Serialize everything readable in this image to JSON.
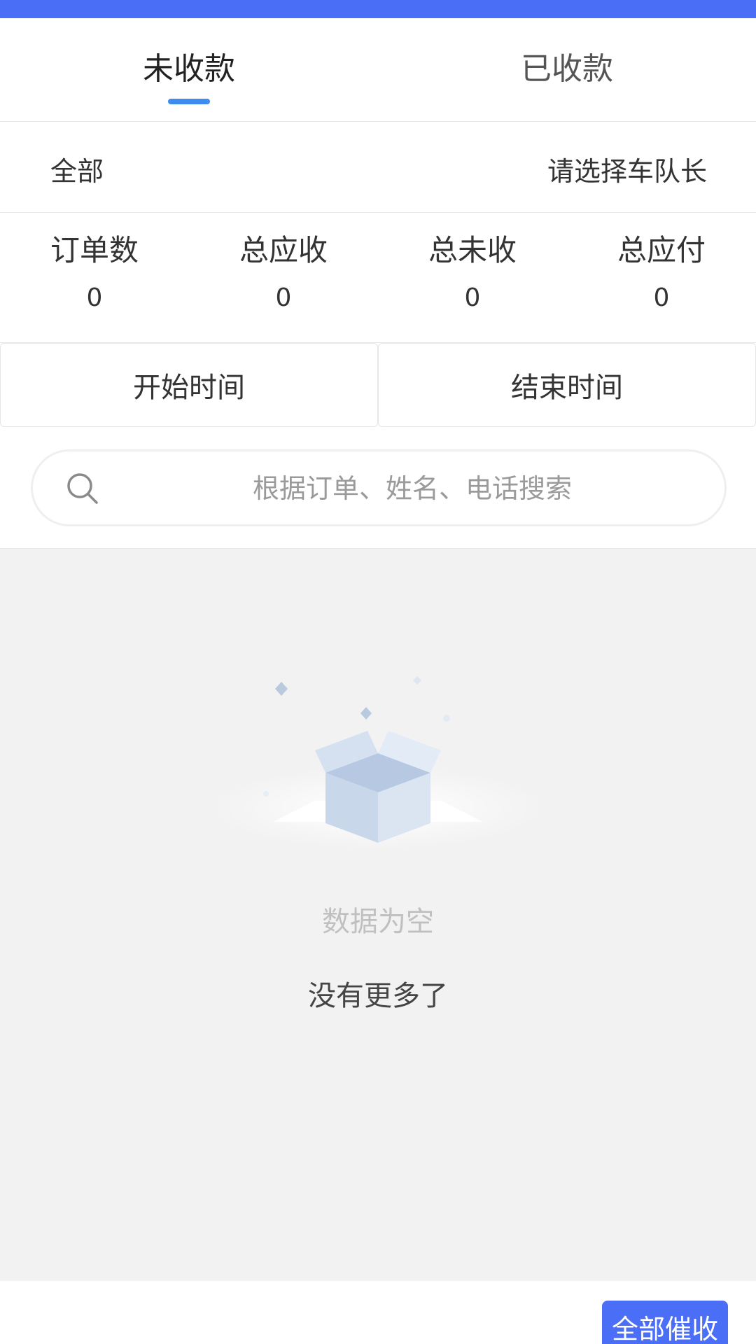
{
  "tabs": [
    {
      "label": "未收款",
      "active": true
    },
    {
      "label": "已收款",
      "active": false
    }
  ],
  "filter": {
    "scope_label": "全部",
    "captain_placeholder": "请选择车队长"
  },
  "stats": [
    {
      "label": "订单数",
      "value": "0"
    },
    {
      "label": "总应收",
      "value": "0"
    },
    {
      "label": "总未收",
      "value": "0"
    },
    {
      "label": "总应付",
      "value": "0"
    }
  ],
  "dates": {
    "start_label": "开始时间",
    "end_label": "结束时间"
  },
  "search": {
    "placeholder": "根据订单、姓名、电话搜索",
    "icon": "search-icon"
  },
  "empty": {
    "icon": "empty-box-icon",
    "text": "数据为空",
    "no_more": "没有更多了"
  },
  "footer": {
    "remind_all_label": "全部催收"
  },
  "colors": {
    "accent": "#4b6ef7",
    "tab_indicator": "#3f8cf0",
    "background": "#f2f2f3"
  }
}
